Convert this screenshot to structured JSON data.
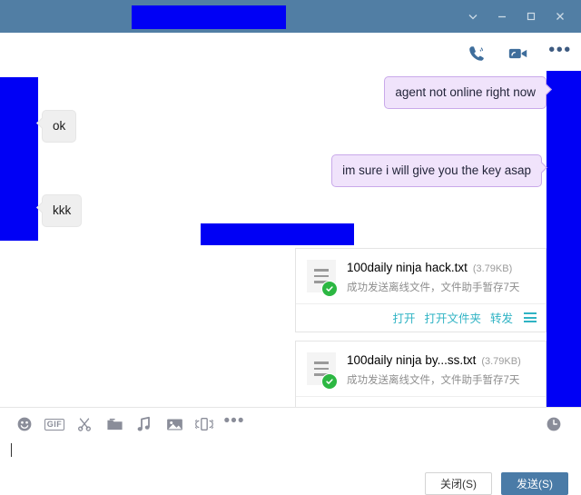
{
  "window": {
    "title_redacted": true,
    "controls": [
      {
        "name": "collapse",
        "glyph": "chevron-down"
      },
      {
        "name": "minimize",
        "glyph": "minus"
      },
      {
        "name": "maximize",
        "glyph": "square"
      },
      {
        "name": "close",
        "glyph": "x"
      }
    ],
    "titlebar_color": "#517ea4",
    "redaction_color": "#0000f5"
  },
  "chat_header": {
    "actions": [
      {
        "name": "audio-call",
        "label": ""
      },
      {
        "name": "video-call",
        "label": ""
      },
      {
        "name": "more-options",
        "label": "•••"
      }
    ]
  },
  "messages": [
    {
      "id": "out-1",
      "side": "outgoing",
      "text": "agent not online right now"
    },
    {
      "id": "in-1",
      "side": "incoming",
      "text": "ok"
    },
    {
      "id": "out-2",
      "side": "outgoing",
      "text": "im sure i will give you the key asap"
    },
    {
      "id": "in-2",
      "side": "incoming",
      "text": "kkk"
    }
  ],
  "files": [
    {
      "name": "100daily ninja hack.txt",
      "size": "(3.79KB)",
      "status": "成功发送离线文件，文件助手暂存7天",
      "actions": [
        "打开",
        "打开文件夹",
        "转发"
      ]
    },
    {
      "name": "100daily ninja by...ss.txt",
      "size": "(3.79KB)",
      "status": "成功发送离线文件，文件助手暂存7天",
      "actions": []
    }
  ],
  "composer": {
    "tools": [
      {
        "name": "emoji",
        "label": ""
      },
      {
        "name": "gif",
        "label": "GIF"
      },
      {
        "name": "screenshot",
        "label": ""
      },
      {
        "name": "folder",
        "label": ""
      },
      {
        "name": "audio-message",
        "label": ""
      },
      {
        "name": "image",
        "label": ""
      },
      {
        "name": "shake",
        "label": ""
      },
      {
        "name": "more",
        "label": "•••"
      }
    ],
    "history_icon": "clock-icon",
    "input_value": "",
    "buttons": {
      "close_label": "关闭(S)",
      "send_label": "发送(S)"
    }
  },
  "colors": {
    "outgoing_bubble": "#f0e3fb",
    "outgoing_border": "#c9a9ea",
    "incoming_bubble": "#efefef",
    "link_teal": "#2fb3c4",
    "check_green": "#2cb742",
    "primary_blue": "#4a7ba7"
  }
}
